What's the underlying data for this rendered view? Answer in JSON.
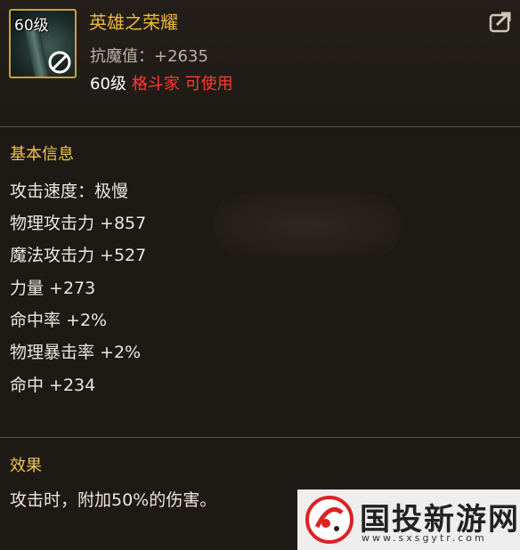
{
  "item": {
    "level_badge": "60级",
    "name": "英雄之荣耀",
    "magic_resist": "抗魔值：+2635",
    "req_level": "60级",
    "req_class": "格斗家 可使用"
  },
  "basic_info": {
    "title": "基本信息",
    "stats": [
      "攻击速度：极慢",
      "物理攻击力 +857",
      "魔法攻击力 +527",
      "力量 +273",
      "命中率 +2%",
      "物理暴击率 +2%",
      "命中 +234"
    ]
  },
  "effect": {
    "title": "效果",
    "text": "攻击时，附加50%的伤害。"
  },
  "watermark": {
    "text": "国投新游网",
    "url": "www.sxsgytr.com"
  },
  "icons": {
    "forbid": "forbidden-icon",
    "compare": "share-export-icon"
  },
  "colors": {
    "item_name": "#f0b83a",
    "class_restriction": "#ff3b2f",
    "section_title": "#f0c34a",
    "icon_border": "#c9a23c"
  }
}
